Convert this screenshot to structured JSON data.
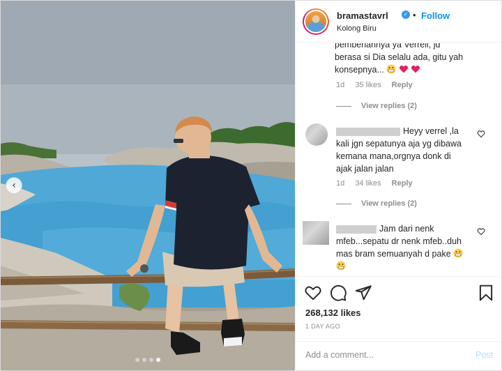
{
  "header": {
    "username": "bramastavrl",
    "verified_icon": "verified-badge-icon",
    "separator": "•",
    "follow_label": "Follow",
    "location": "Kolong Biru"
  },
  "photo": {
    "prev_icon": "chevron-left-icon",
    "carousel_count": 4,
    "carousel_active_index": 3
  },
  "comments": [
    {
      "lines": [
        "pemberiannya ya Verrell, jd",
        "berasa si Dia selalu ada, gitu yah",
        "konsepnya..."
      ],
      "emojis": [
        "grimace-emoji",
        "heart-emoji",
        "heart-emoji"
      ],
      "age": "1d",
      "likes": "35 likes",
      "reply_label": "Reply",
      "view_replies": "View replies (2)"
    },
    {
      "lines": [
        "Heyy verrel ,la",
        "kali jgn sepatunya aja yg dibawa",
        "kemana mana,orgnya donk di",
        "ajak jalan jalan"
      ],
      "age": "1d",
      "likes": "34 likes",
      "reply_label": "Reply",
      "view_replies": "View replies (2)"
    },
    {
      "lines": [
        "Jam dari nenk",
        "mfeb...sepatu dr nenk mfeb..duh",
        "mas bram semuanyah d pake"
      ],
      "emojis": [
        "grimace-emoji",
        "grimace-emoji"
      ]
    }
  ],
  "actions": {
    "like_icon": "heart-icon",
    "comment_icon": "comment-icon",
    "share_icon": "paper-plane-icon",
    "save_icon": "bookmark-icon",
    "likes_count": "268,132 likes",
    "posted": "1 DAY AGO"
  },
  "add_comment": {
    "placeholder": "Add a comment...",
    "post_label": "Post"
  },
  "colors": {
    "link_blue": "#0095f6",
    "post_disabled": "#b2dffc",
    "heart_red": "#ed4956",
    "muted": "#8e8e8e"
  }
}
